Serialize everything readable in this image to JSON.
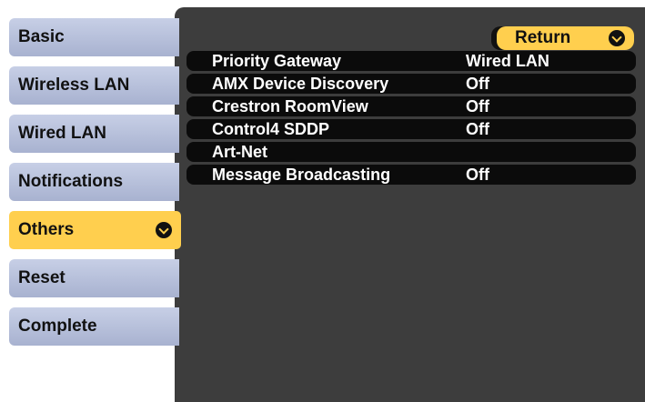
{
  "sidebar": {
    "items": [
      {
        "label": "Basic"
      },
      {
        "label": "Wireless LAN"
      },
      {
        "label": "Wired LAN"
      },
      {
        "label": "Notifications"
      },
      {
        "label": "Others",
        "active": true
      },
      {
        "label": "Reset"
      },
      {
        "label": "Complete"
      }
    ]
  },
  "main": {
    "return_label": "Return",
    "rows": [
      {
        "label": "Priority Gateway",
        "value": "Wired LAN"
      },
      {
        "label": "AMX Device Discovery",
        "value": "Off"
      },
      {
        "label": "Crestron RoomView",
        "value": "Off"
      },
      {
        "label": "Control4 SDDP",
        "value": "Off"
      },
      {
        "label": "Art-Net",
        "value": ""
      },
      {
        "label": "Message Broadcasting",
        "value": "Off"
      }
    ]
  },
  "colors": {
    "highlight": "#ffcf4e",
    "tab_bg": "#b8c0dc",
    "panel_bg": "#3d3d3d",
    "row_bg": "#0b0b0b"
  },
  "icons": {
    "enter": "enter-icon"
  }
}
